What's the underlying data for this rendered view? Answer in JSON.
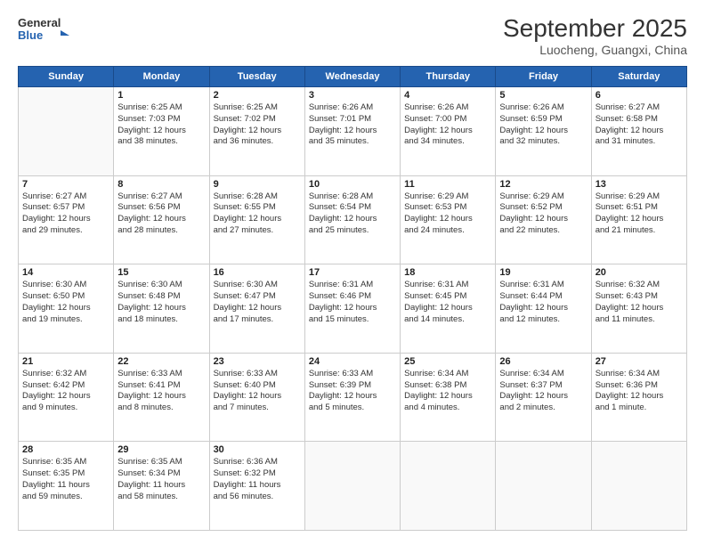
{
  "header": {
    "logo_general": "General",
    "logo_blue": "Blue",
    "title": "September 2025",
    "subtitle": "Luocheng, Guangxi, China"
  },
  "days_of_week": [
    "Sunday",
    "Monday",
    "Tuesday",
    "Wednesday",
    "Thursday",
    "Friday",
    "Saturday"
  ],
  "weeks": [
    [
      {
        "num": "",
        "info": ""
      },
      {
        "num": "1",
        "info": "Sunrise: 6:25 AM\nSunset: 7:03 PM\nDaylight: 12 hours\nand 38 minutes."
      },
      {
        "num": "2",
        "info": "Sunrise: 6:25 AM\nSunset: 7:02 PM\nDaylight: 12 hours\nand 36 minutes."
      },
      {
        "num": "3",
        "info": "Sunrise: 6:26 AM\nSunset: 7:01 PM\nDaylight: 12 hours\nand 35 minutes."
      },
      {
        "num": "4",
        "info": "Sunrise: 6:26 AM\nSunset: 7:00 PM\nDaylight: 12 hours\nand 34 minutes."
      },
      {
        "num": "5",
        "info": "Sunrise: 6:26 AM\nSunset: 6:59 PM\nDaylight: 12 hours\nand 32 minutes."
      },
      {
        "num": "6",
        "info": "Sunrise: 6:27 AM\nSunset: 6:58 PM\nDaylight: 12 hours\nand 31 minutes."
      }
    ],
    [
      {
        "num": "7",
        "info": "Sunrise: 6:27 AM\nSunset: 6:57 PM\nDaylight: 12 hours\nand 29 minutes."
      },
      {
        "num": "8",
        "info": "Sunrise: 6:27 AM\nSunset: 6:56 PM\nDaylight: 12 hours\nand 28 minutes."
      },
      {
        "num": "9",
        "info": "Sunrise: 6:28 AM\nSunset: 6:55 PM\nDaylight: 12 hours\nand 27 minutes."
      },
      {
        "num": "10",
        "info": "Sunrise: 6:28 AM\nSunset: 6:54 PM\nDaylight: 12 hours\nand 25 minutes."
      },
      {
        "num": "11",
        "info": "Sunrise: 6:29 AM\nSunset: 6:53 PM\nDaylight: 12 hours\nand 24 minutes."
      },
      {
        "num": "12",
        "info": "Sunrise: 6:29 AM\nSunset: 6:52 PM\nDaylight: 12 hours\nand 22 minutes."
      },
      {
        "num": "13",
        "info": "Sunrise: 6:29 AM\nSunset: 6:51 PM\nDaylight: 12 hours\nand 21 minutes."
      }
    ],
    [
      {
        "num": "14",
        "info": "Sunrise: 6:30 AM\nSunset: 6:50 PM\nDaylight: 12 hours\nand 19 minutes."
      },
      {
        "num": "15",
        "info": "Sunrise: 6:30 AM\nSunset: 6:48 PM\nDaylight: 12 hours\nand 18 minutes."
      },
      {
        "num": "16",
        "info": "Sunrise: 6:30 AM\nSunset: 6:47 PM\nDaylight: 12 hours\nand 17 minutes."
      },
      {
        "num": "17",
        "info": "Sunrise: 6:31 AM\nSunset: 6:46 PM\nDaylight: 12 hours\nand 15 minutes."
      },
      {
        "num": "18",
        "info": "Sunrise: 6:31 AM\nSunset: 6:45 PM\nDaylight: 12 hours\nand 14 minutes."
      },
      {
        "num": "19",
        "info": "Sunrise: 6:31 AM\nSunset: 6:44 PM\nDaylight: 12 hours\nand 12 minutes."
      },
      {
        "num": "20",
        "info": "Sunrise: 6:32 AM\nSunset: 6:43 PM\nDaylight: 12 hours\nand 11 minutes."
      }
    ],
    [
      {
        "num": "21",
        "info": "Sunrise: 6:32 AM\nSunset: 6:42 PM\nDaylight: 12 hours\nand 9 minutes."
      },
      {
        "num": "22",
        "info": "Sunrise: 6:33 AM\nSunset: 6:41 PM\nDaylight: 12 hours\nand 8 minutes."
      },
      {
        "num": "23",
        "info": "Sunrise: 6:33 AM\nSunset: 6:40 PM\nDaylight: 12 hours\nand 7 minutes."
      },
      {
        "num": "24",
        "info": "Sunrise: 6:33 AM\nSunset: 6:39 PM\nDaylight: 12 hours\nand 5 minutes."
      },
      {
        "num": "25",
        "info": "Sunrise: 6:34 AM\nSunset: 6:38 PM\nDaylight: 12 hours\nand 4 minutes."
      },
      {
        "num": "26",
        "info": "Sunrise: 6:34 AM\nSunset: 6:37 PM\nDaylight: 12 hours\nand 2 minutes."
      },
      {
        "num": "27",
        "info": "Sunrise: 6:34 AM\nSunset: 6:36 PM\nDaylight: 12 hours\nand 1 minute."
      }
    ],
    [
      {
        "num": "28",
        "info": "Sunrise: 6:35 AM\nSunset: 6:35 PM\nDaylight: 11 hours\nand 59 minutes."
      },
      {
        "num": "29",
        "info": "Sunrise: 6:35 AM\nSunset: 6:34 PM\nDaylight: 11 hours\nand 58 minutes."
      },
      {
        "num": "30",
        "info": "Sunrise: 6:36 AM\nSunset: 6:32 PM\nDaylight: 11 hours\nand 56 minutes."
      },
      {
        "num": "",
        "info": ""
      },
      {
        "num": "",
        "info": ""
      },
      {
        "num": "",
        "info": ""
      },
      {
        "num": "",
        "info": ""
      }
    ]
  ]
}
